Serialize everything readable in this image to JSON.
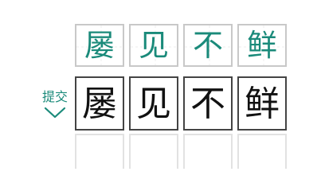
{
  "submit_label": "提交",
  "hint_row": [
    {
      "char": "屡",
      "tone": "teal"
    },
    {
      "char": "见",
      "tone": "teal"
    },
    {
      "char": "不",
      "tone": "teal"
    },
    {
      "char": "鲜",
      "tone": "teal"
    }
  ],
  "answer_row": [
    "屡",
    "见",
    "不",
    "鲜"
  ],
  "colors": {
    "accent": "#1a8a7a",
    "border_dark": "#444444",
    "border_light": "#c8c8c8"
  },
  "icons": {
    "submit": "chevron-down-icon"
  }
}
